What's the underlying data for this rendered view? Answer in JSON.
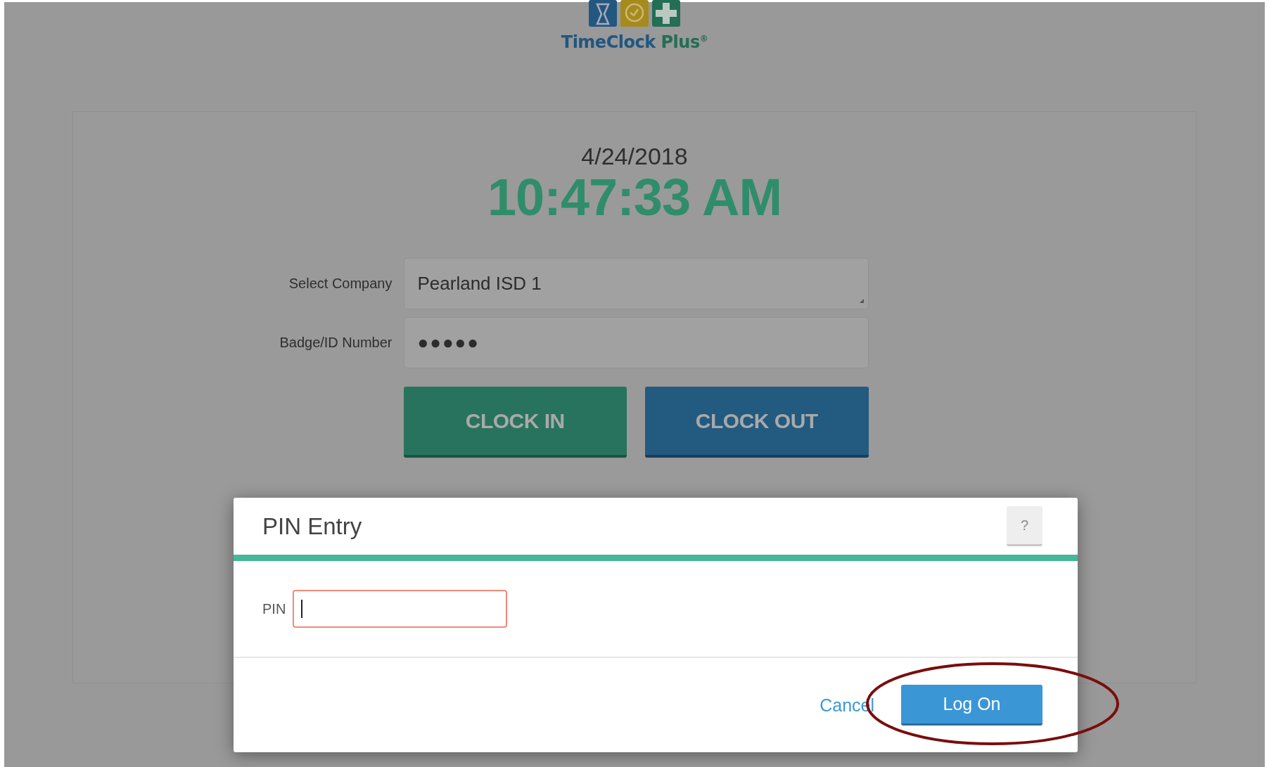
{
  "logo": {
    "name": "TimeClock",
    "suffix": "Plus",
    "mark": "®"
  },
  "clock": {
    "date": "4/24/2018",
    "time": "10:47:33 AM"
  },
  "form": {
    "fields": [
      {
        "label": "Select Company",
        "kind": "select",
        "value": "Pearland ISD  1"
      },
      {
        "label": "Badge/ID Number",
        "kind": "password",
        "value": "●●●●●"
      }
    ],
    "buttons": [
      {
        "label": "CLOCK IN",
        "kind": "in"
      },
      {
        "label": "CLOCK OUT",
        "kind": "out"
      }
    ]
  },
  "dialog": {
    "title": "PIN Entry",
    "help": "?",
    "field": {
      "label": "PIN",
      "focused": true
    },
    "cancel": "Cancel",
    "submit": "Log On",
    "highlighted": true
  }
}
